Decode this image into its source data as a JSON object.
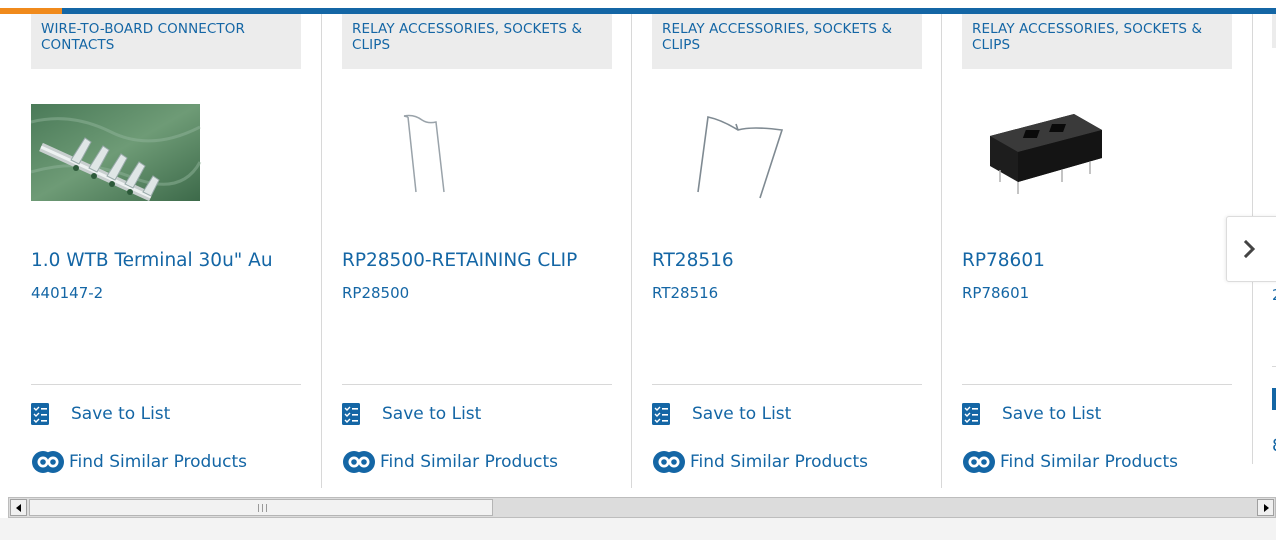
{
  "brand": {
    "accent": "#f08a1c",
    "primary": "#1466a5",
    "category_bg": "#ececec"
  },
  "products": [
    {
      "category": "WIRE-TO-BOARD CONNECTOR CONTACTS",
      "title": "1.0 WTB Terminal 30u\" Au",
      "part_number": "440147-2",
      "save_label": "Save to List",
      "find_label": "Find Similar Products"
    },
    {
      "category": "RELAY ACCESSORIES, SOCKETS & CLIPS",
      "title": "RP28500-RETAINING CLIP",
      "part_number": "RP28500",
      "save_label": "Save to List",
      "find_label": "Find Similar Products"
    },
    {
      "category": "RELAY ACCESSORIES, SOCKETS & CLIPS",
      "title": "RT28516",
      "part_number": "RT28516",
      "save_label": "Save to List",
      "find_label": "Find Similar Products"
    },
    {
      "category": "RELAY ACCESSORIES, SOCKETS & CLIPS",
      "title": "RP78601",
      "part_number": "RP78601",
      "save_label": "Save to List",
      "find_label": "Find Similar Products"
    }
  ],
  "partial_card": {
    "part_number_fragment": "2",
    "find_fragment": "8"
  },
  "icons": {
    "next": "chevron-right-icon",
    "save": "checklist-icon",
    "find": "find-similar-icon"
  }
}
